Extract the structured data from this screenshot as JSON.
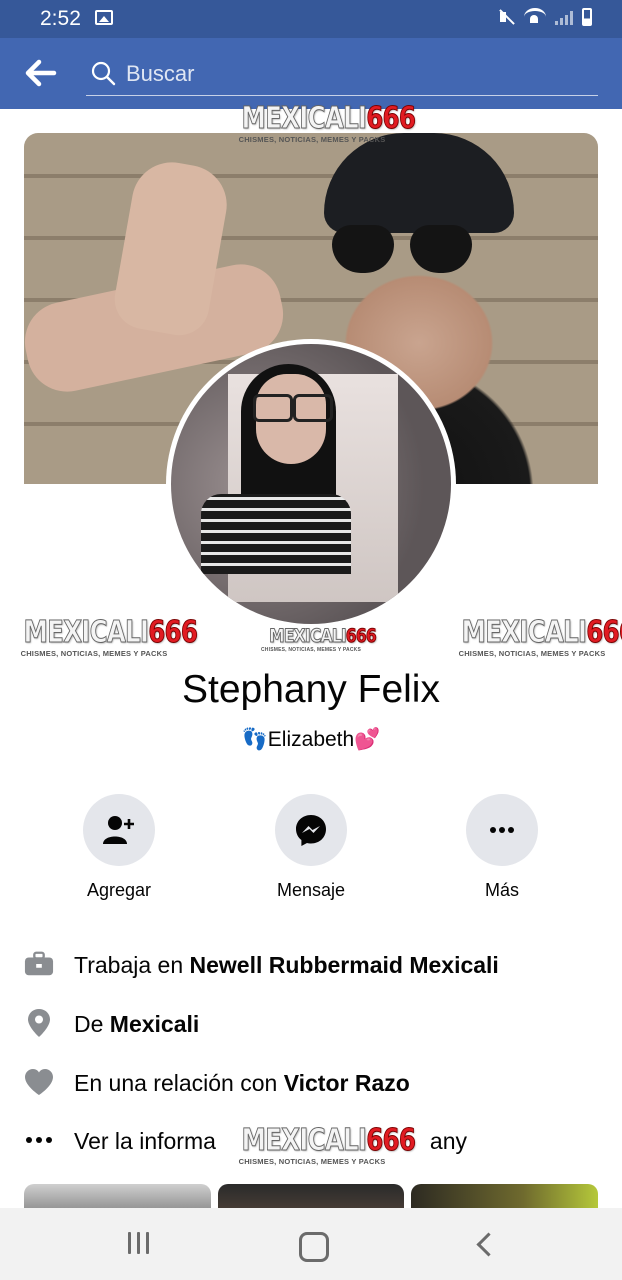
{
  "status_bar": {
    "time": "2:52"
  },
  "search": {
    "placeholder": "Buscar"
  },
  "watermark": {
    "brand_text": "MEXICALI",
    "brand_number": "666",
    "tagline": "CHISMES, NOTICIAS, MEMES Y PACKS"
  },
  "profile": {
    "name": "Stephany Felix",
    "bio": "👣Elizabeth💕"
  },
  "actions": [
    {
      "label": "Agregar",
      "icon": "add-friend-icon"
    },
    {
      "label": "Mensaje",
      "icon": "messenger-icon"
    },
    {
      "label": "Más",
      "icon": "more-icon"
    }
  ],
  "info": {
    "work": {
      "prefix": "Trabaja en ",
      "value": "Newell Rubbermaid Mexicali",
      "icon": "briefcase-icon"
    },
    "from": {
      "prefix": "De ",
      "value": "Mexicali",
      "icon": "location-pin-icon"
    },
    "relationship": {
      "prefix": "En una relación con ",
      "value": "Victor Razo",
      "icon": "heart-icon"
    },
    "more": {
      "text": "Ver la informa",
      "tail": "any",
      "icon": "more-dots-icon"
    }
  },
  "colors": {
    "header": "#4267b2",
    "status_bar": "#365899",
    "action_bg": "#e4e6eb",
    "watermark_red": "#e11b22"
  }
}
